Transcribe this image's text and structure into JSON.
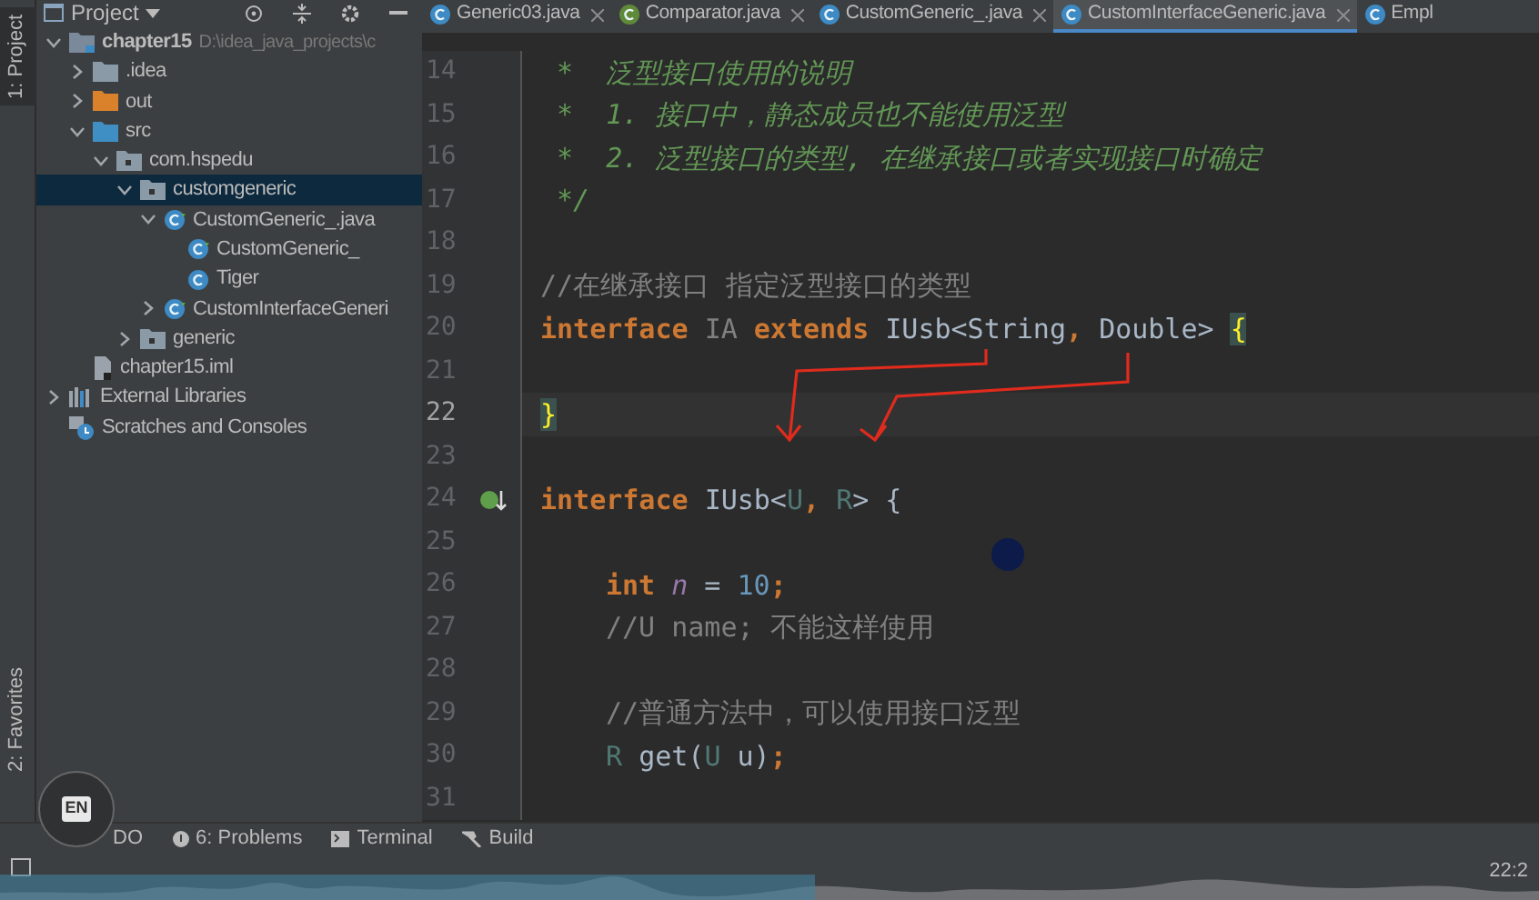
{
  "left_strip": {
    "top_label": "1: Project",
    "bottom_label": "2: Favorites"
  },
  "project_panel": {
    "title": "Project",
    "tree": [
      {
        "label": "chapter15",
        "path": "D:\\idea_java_projects\\c",
        "kind": "module",
        "expanded": true,
        "selected": false,
        "children": [
          {
            "label": ".idea",
            "kind": "folder",
            "expanded": false,
            "selected": false
          },
          {
            "label": "out",
            "kind": "excluded",
            "expanded": false,
            "selected": false
          },
          {
            "label": "src",
            "kind": "source",
            "expanded": true,
            "selected": false,
            "children": [
              {
                "label": "com.hspedu",
                "kind": "package",
                "expanded": true,
                "selected": false,
                "children": [
                  {
                    "label": "customgeneric",
                    "kind": "package",
                    "expanded": true,
                    "selected": true,
                    "children": [
                      {
                        "label": "CustomGeneric_.java",
                        "kind": "classfile",
                        "expanded": true,
                        "selected": false,
                        "children": [
                          {
                            "label": "CustomGeneric_",
                            "kind": "classfile",
                            "selected": false
                          },
                          {
                            "label": "Tiger",
                            "kind": "class",
                            "selected": false
                          }
                        ]
                      },
                      {
                        "label": "CustomInterfaceGeneri",
                        "kind": "classfile",
                        "expanded": false,
                        "selected": false
                      }
                    ]
                  },
                  {
                    "label": "generic",
                    "kind": "package",
                    "expanded": false,
                    "selected": false
                  }
                ]
              }
            ]
          },
          {
            "label": "chapter15.iml",
            "kind": "file",
            "selected": false
          }
        ]
      },
      {
        "label": "External Libraries",
        "kind": "libraries",
        "expanded": false,
        "selected": false
      },
      {
        "label": "Scratches and Consoles",
        "kind": "scratches",
        "selected": false
      }
    ]
  },
  "editor_tabs": [
    {
      "label": "Generic03.java",
      "kind": "class",
      "selected": false,
      "closable": true
    },
    {
      "label": "Comparator.java",
      "kind": "interface",
      "selected": false,
      "closable": true
    },
    {
      "label": "CustomGeneric_.java",
      "kind": "class",
      "selected": false,
      "closable": true
    },
    {
      "label": "CustomInterfaceGeneric.java",
      "kind": "class",
      "selected": true,
      "closable": true
    },
    {
      "label": "Empl",
      "kind": "class",
      "selected": false,
      "closable": false
    }
  ],
  "code_lines": [
    {
      "number": "14",
      "current": false,
      "kind": "top",
      "tokens": [
        {
          "kind": "doc",
          "text": " *  泛型接口使用的说明"
        }
      ]
    },
    {
      "number": "15",
      "current": false,
      "kind": "top",
      "tokens": [
        {
          "kind": "doc",
          "text": " *  1. 接口中，静态成员也不能使用泛型"
        }
      ]
    },
    {
      "number": "16",
      "current": false,
      "kind": "top",
      "tokens": [
        {
          "kind": "doc",
          "text": " *  2. 泛型接口的类型, 在继承接口或者实现接口时确定"
        }
      ]
    },
    {
      "number": "17",
      "current": false,
      "kind": "top",
      "tokens": [
        {
          "kind": "doc",
          "text": " */"
        }
      ]
    },
    {
      "number": "18",
      "current": false,
      "kind": "top"
    },
    {
      "number": "19",
      "current": false,
      "kind": "top",
      "tokens": [
        {
          "kind": "comment",
          "text": "//在继承接口 指定泛型接口的类型"
        }
      ]
    },
    {
      "number": "20",
      "current": false,
      "kind": "top",
      "tokens": [
        {
          "kind": "keyword",
          "text": "interface "
        },
        {
          "kind": "unused",
          "text": "IA "
        },
        {
          "kind": "keyword",
          "text": "extends "
        },
        {
          "kind": "ident",
          "text": "IUsb<String"
        },
        {
          "kind": "keyword",
          "text": ", "
        },
        {
          "kind": "ident",
          "text": "Double> "
        },
        {
          "kind": "brace",
          "text": "{"
        }
      ]
    },
    {
      "number": "21",
      "current": false,
      "kind": "top"
    },
    {
      "number": "22",
      "current": true,
      "kind": "top",
      "tokens": [
        {
          "kind": "brace",
          "text": "}"
        }
      ]
    },
    {
      "number": "23",
      "current": false,
      "kind": "top"
    },
    {
      "number": "24",
      "current": false,
      "kind": "implemented",
      "tokens": [
        {
          "kind": "keyword",
          "text": "interface "
        },
        {
          "kind": "ident",
          "text": "IUsb<"
        },
        {
          "kind": "typeparam",
          "text": "U"
        },
        {
          "kind": "keyword",
          "text": ", "
        },
        {
          "kind": "typeparam",
          "text": "R"
        },
        {
          "kind": "ident",
          "text": "> {"
        }
      ]
    },
    {
      "number": "25",
      "current": false,
      "kind": "member"
    },
    {
      "number": "26",
      "current": false,
      "kind": "member",
      "tokens": [
        {
          "kind": "keyword",
          "text": "int "
        },
        {
          "kind": "field",
          "text": "n"
        },
        {
          "kind": "ident",
          "text": " = "
        },
        {
          "kind": "number",
          "text": "10"
        },
        {
          "kind": "keyword",
          "text": ";"
        }
      ]
    },
    {
      "number": "27",
      "current": false,
      "kind": "member",
      "tokens": [
        {
          "kind": "comment",
          "text": "//U name; 不能这样使用"
        }
      ]
    },
    {
      "number": "28",
      "current": false,
      "kind": "member"
    },
    {
      "number": "29",
      "current": false,
      "kind": "member",
      "tokens": [
        {
          "kind": "comment",
          "text": "//普通方法中，可以使用接口泛型"
        }
      ]
    },
    {
      "number": "30",
      "current": false,
      "kind": "member",
      "tokens": [
        {
          "kind": "typeparam",
          "text": "R "
        },
        {
          "kind": "ident",
          "text": "get("
        },
        {
          "kind": "typeparam",
          "text": "U "
        },
        {
          "kind": "ident",
          "text": "u)"
        },
        {
          "kind": "keyword",
          "text": ";"
        }
      ]
    },
    {
      "number": "31",
      "current": false,
      "kind": "member"
    }
  ],
  "overlay_badge": {
    "text": "EN"
  },
  "bottom_toolbar": [
    {
      "label": "DO",
      "kind": "plain"
    },
    {
      "label": "6: Problems",
      "kind": "problems"
    },
    {
      "label": "Terminal",
      "kind": "terminal"
    },
    {
      "label": "Build",
      "kind": "build"
    }
  ],
  "status_bar": {
    "position": "22:2"
  },
  "playback": {
    "level": 0.53
  }
}
